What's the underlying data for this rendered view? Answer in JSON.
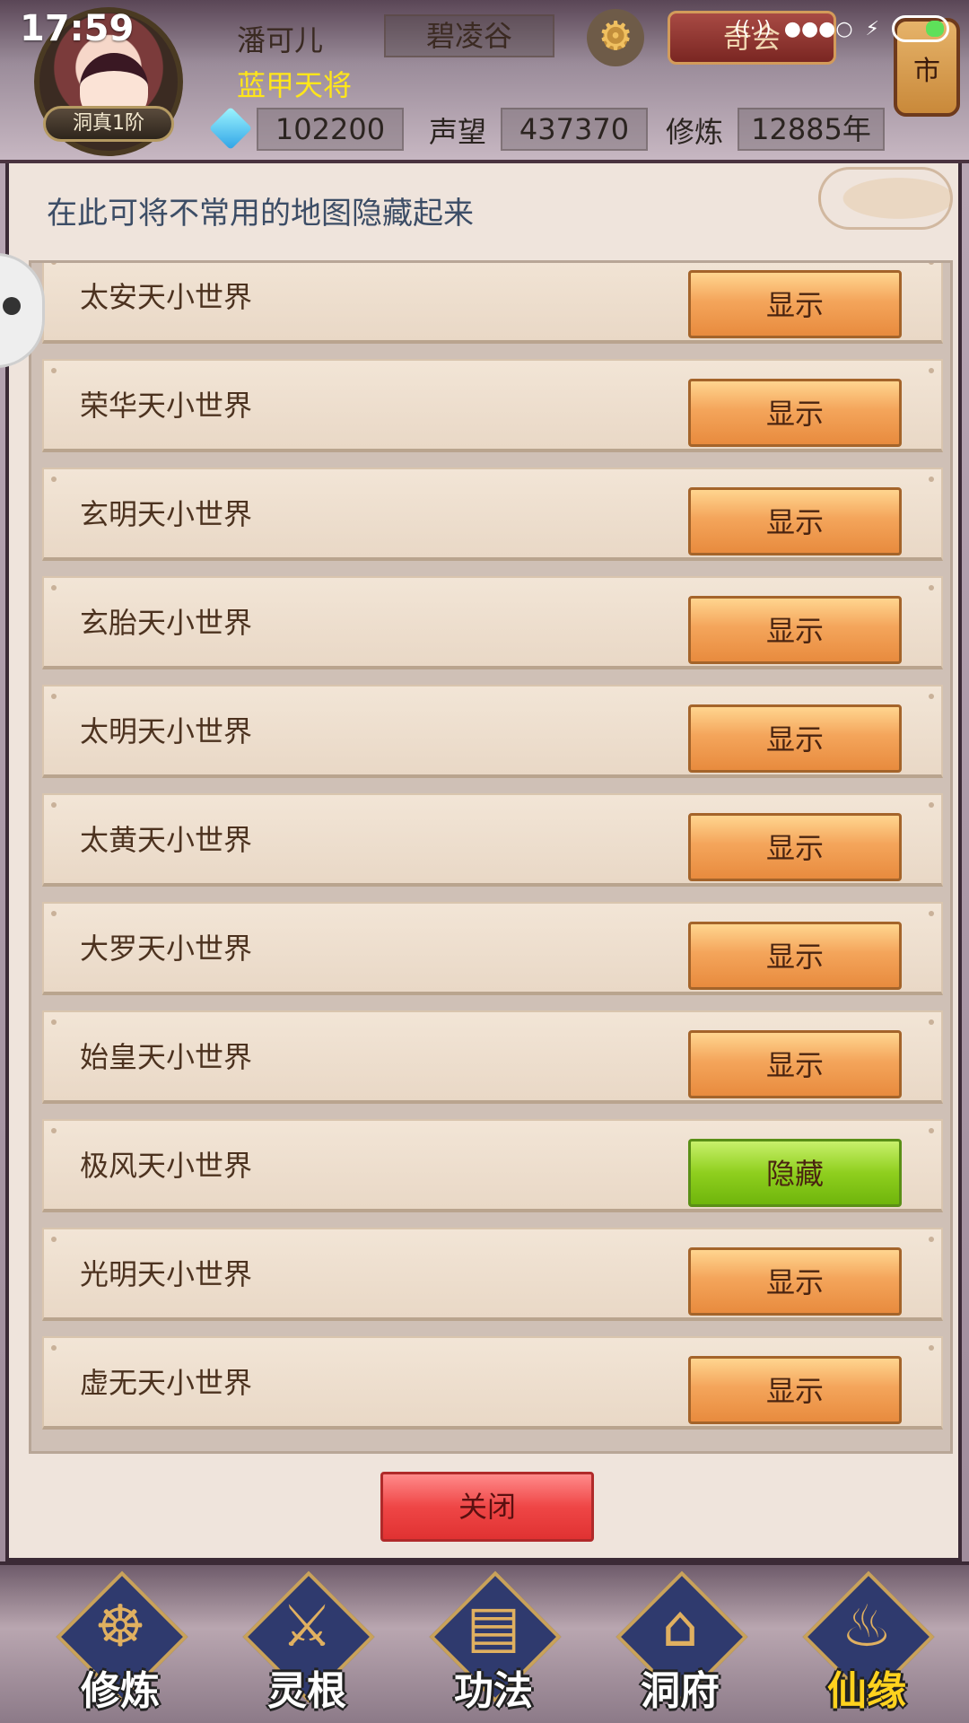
{
  "status_bar": {
    "time": "17:59"
  },
  "header": {
    "player_name": "潘可儿",
    "rank": "洞真1阶",
    "location": "碧凌谷",
    "guild_button": "奇会",
    "title": "蓝甲天将",
    "spirit_stones": "102200",
    "prestige_label": "声望",
    "prestige": "437370",
    "cultivation_label": "修炼",
    "cultivation": "12885年",
    "market_label": "市"
  },
  "dialog": {
    "hint": "在此可将不常用的地图隐藏起来",
    "rows": [
      {
        "label": "太安天小世界",
        "button": "显示",
        "state": "show"
      },
      {
        "label": "荣华天小世界",
        "button": "显示",
        "state": "show"
      },
      {
        "label": "玄明天小世界",
        "button": "显示",
        "state": "show"
      },
      {
        "label": "玄胎天小世界",
        "button": "显示",
        "state": "show"
      },
      {
        "label": "太明天小世界",
        "button": "显示",
        "state": "show"
      },
      {
        "label": "太黄天小世界",
        "button": "显示",
        "state": "show"
      },
      {
        "label": "大罗天小世界",
        "button": "显示",
        "state": "show"
      },
      {
        "label": "始皇天小世界",
        "button": "显示",
        "state": "show"
      },
      {
        "label": "极风天小世界",
        "button": "隐藏",
        "state": "hide"
      },
      {
        "label": "光明天小世界",
        "button": "显示",
        "state": "show"
      },
      {
        "label": "虚无天小世界",
        "button": "显示",
        "state": "show"
      }
    ],
    "close_button": "关闭"
  },
  "bottom_nav": [
    {
      "label": "修炼",
      "icon": "monk-icon"
    },
    {
      "label": "灵根",
      "icon": "sword-icon"
    },
    {
      "label": "功法",
      "icon": "book-icon"
    },
    {
      "label": "洞府",
      "icon": "pagoda-icon"
    },
    {
      "label": "仙缘",
      "icon": "gourd-icon"
    }
  ],
  "colors": {
    "show_button": "#f4a55b",
    "hide_button": "#8fcf1e",
    "close_button": "#ef4646",
    "title_yellow": "#ffe619"
  }
}
